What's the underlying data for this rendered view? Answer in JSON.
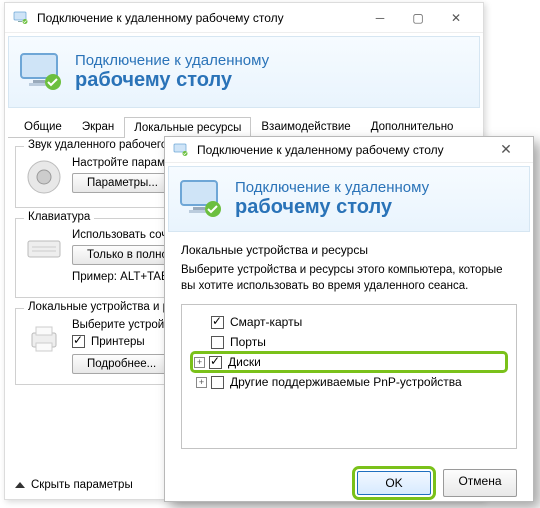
{
  "app": {
    "title": "Подключение к удаленному рабочему столу",
    "banner_line1": "Подключение к удаленному",
    "banner_line2": "рабочему столу"
  },
  "tabs": [
    "Общие",
    "Экран",
    "Локальные ресурсы",
    "Взаимодействие",
    "Дополнительно"
  ],
  "active_tab_index": 2,
  "group_audio": {
    "title": "Звук удаленного рабочего стола",
    "line": "Настройте параметры звука удаленного рабочего стола.",
    "button": "Параметры..."
  },
  "group_keyboard": {
    "title": "Клавиатура",
    "line1": "Использовать сочетания клавиш Windows:",
    "select": "Только в полноэкранном режиме",
    "line2": "Пример: ALT+TAB"
  },
  "group_devices": {
    "title": "Локальные устройства и ресурсы",
    "line": "Выберите устройства и ресурсы, которые вы хотите использовать.",
    "checkbox": "Принтеры",
    "button": "Подробнее..."
  },
  "footer_back": "Скрыть параметры",
  "front": {
    "title": "Подключение к удаленному рабочему столу",
    "section": "Локальные устройства и ресурсы",
    "instruction": "Выберите устройства и ресурсы этого компьютера, которые вы хотите использовать во время удаленного сеанса.",
    "tree": [
      {
        "expand": "",
        "checked": true,
        "label": "Смарт-карты",
        "highlight": false
      },
      {
        "expand": "",
        "checked": false,
        "label": "Порты",
        "highlight": false
      },
      {
        "expand": "+",
        "checked": true,
        "label": "Диски",
        "highlight": true
      },
      {
        "expand": "+",
        "checked": false,
        "label": "Другие поддерживаемые PnP-устройства",
        "highlight": false
      }
    ],
    "ok": "OK",
    "cancel": "Отмена"
  },
  "icons": {
    "monitor": "monitor-icon",
    "speaker": "speaker-icon",
    "keyboard": "keyboard-icon",
    "printer": "printer-icon"
  }
}
